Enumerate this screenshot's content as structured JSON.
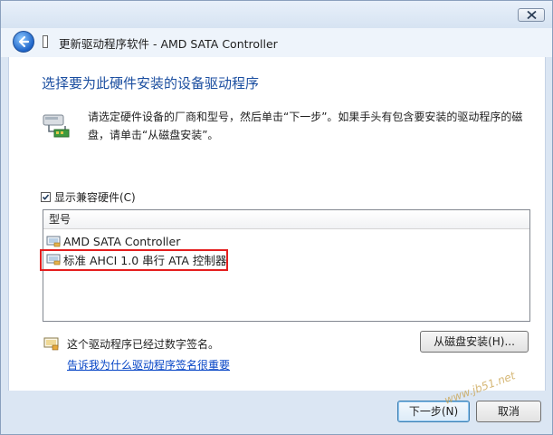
{
  "window": {
    "title": "更新驱动程序软件 - AMD SATA Controller",
    "close_icon": "close-icon",
    "back_icon": "back-arrow-icon"
  },
  "page": {
    "heading": "选择要为此硬件安装的设备驱动程序",
    "instruction": "请选定硬件设备的厂商和型号，然后单击“下一步”。如果手头有包含要安装的驱动程序的磁盘，请单击“从磁盘安装”。",
    "instruction_icon": "hardware-device-icon"
  },
  "compat": {
    "label": "显示兼容硬件(C)",
    "checked": true
  },
  "model_list": {
    "column_header": "型号",
    "items": [
      {
        "label": "AMD SATA Controller",
        "icon": "driver-icon"
      },
      {
        "label": "标准 AHCI 1.0 串行 ATA 控制器",
        "icon": "driver-icon"
      }
    ]
  },
  "signature": {
    "text": "这个驱动程序已经过数字签名。",
    "link": "告诉我为什么驱动程序签名很重要",
    "icon": "signed-driver-icon"
  },
  "buttons": {
    "have_disk": "从磁盘安装(H)...",
    "next": "下一步(N)",
    "cancel": "取消"
  },
  "watermark": "www.jb51.net",
  "colors": {
    "heading": "#1b4ea0",
    "link": "#0645c6",
    "highlight": "#e41e1e",
    "frame": "#dbe6f3"
  }
}
